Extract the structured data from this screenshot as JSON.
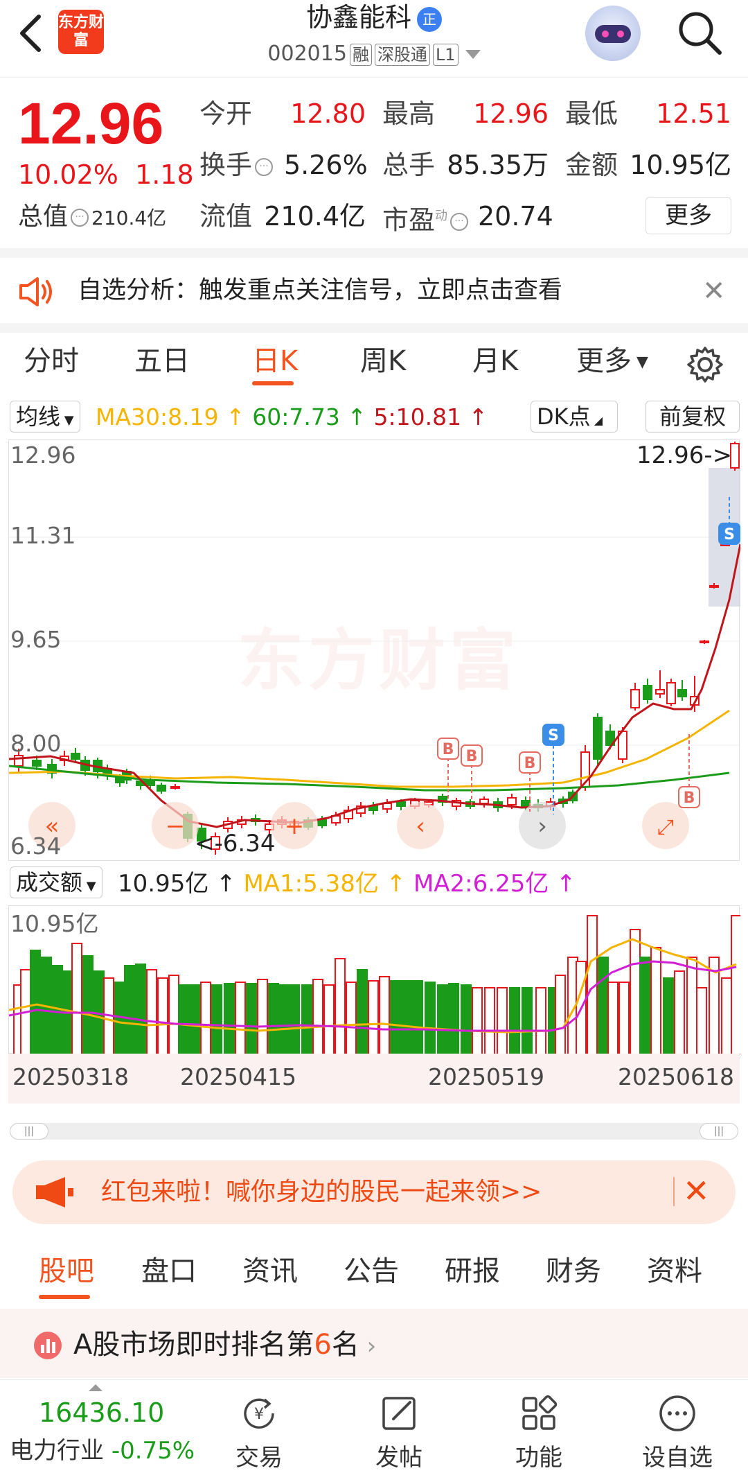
{
  "header": {
    "logo_text": "东方财富",
    "stock_name": "协鑫能科",
    "zheng_badge": "正",
    "stock_code": "002015",
    "tags": [
      "融",
      "深股通",
      "L1"
    ]
  },
  "quote": {
    "price": "12.96",
    "change_pct": "10.02%",
    "change_amt": "1.18",
    "total_value_label": "总值",
    "total_value": "210.4亿",
    "stats": [
      {
        "label": "今开",
        "value": "12.80",
        "color": "red"
      },
      {
        "label": "最高",
        "value": "12.96",
        "color": "red"
      },
      {
        "label": "最低",
        "value": "12.51",
        "color": "red"
      },
      {
        "label": "换手",
        "value": "5.26%",
        "color": "dark",
        "info": true
      },
      {
        "label": "总手",
        "value": "85.35万",
        "color": "dark"
      },
      {
        "label": "金额",
        "value": "10.95亿",
        "color": "dark"
      },
      {
        "label": "流值",
        "value": "210.4亿",
        "color": "dark"
      },
      {
        "label": "市盈",
        "value": "20.74",
        "color": "dark",
        "info": true,
        "sup": "动"
      }
    ],
    "more_label": "更多"
  },
  "notice": {
    "text": "自选分析：触发重点关注信号，立即点击查看",
    "close": "✕"
  },
  "chart_tabs": [
    "分时",
    "五日",
    "日K",
    "周K",
    "月K",
    "更多"
  ],
  "active_chart_tab": "日K",
  "indicator": {
    "ma_select": "均线",
    "ma30": "MA30:8.19",
    "ma60": "60:7.73",
    "ma5": "5:10.81",
    "dk": "DK点",
    "adjust": "前复权"
  },
  "kline": {
    "y_labels": [
      "12.96",
      "11.31",
      "9.65",
      "8.00",
      "6.34"
    ],
    "last_price_label": "12.96->",
    "low_label": "<-6.34",
    "watermark": "东方财富",
    "signals": [
      "B",
      "B",
      "B",
      "S",
      "B",
      "S"
    ]
  },
  "volume": {
    "select": "成交额",
    "current": "10.95亿",
    "ma1": "MA1:5.38亿",
    "ma2": "MA2:6.25亿",
    "max_label": "10.95亿",
    "dates": [
      "20250318",
      "20250415",
      "20250519",
      "20250618"
    ]
  },
  "packet": {
    "text": "红包来啦！喊你身边的股民一起来领>>",
    "close": "✕"
  },
  "bottom_tabs": [
    "股吧",
    "盘口",
    "资讯",
    "公告",
    "研报",
    "财务",
    "资料"
  ],
  "active_bottom_tab": "股吧",
  "rank": {
    "prefix": "A股市场即时排名第",
    "num": "6",
    "suffix": "名"
  },
  "bottom_bar": {
    "index_value": "16436.10",
    "index_name": "电力行业",
    "index_change": "-0.75%",
    "items": [
      "交易",
      "发帖",
      "功能",
      "设自选"
    ]
  },
  "colors": {
    "up": "#e8161b",
    "down": "#1a9c1a",
    "accent": "#f2531f",
    "ma30": "#f5b400",
    "ma60": "#1a9c1a",
    "ma5": "#c0161b"
  }
}
